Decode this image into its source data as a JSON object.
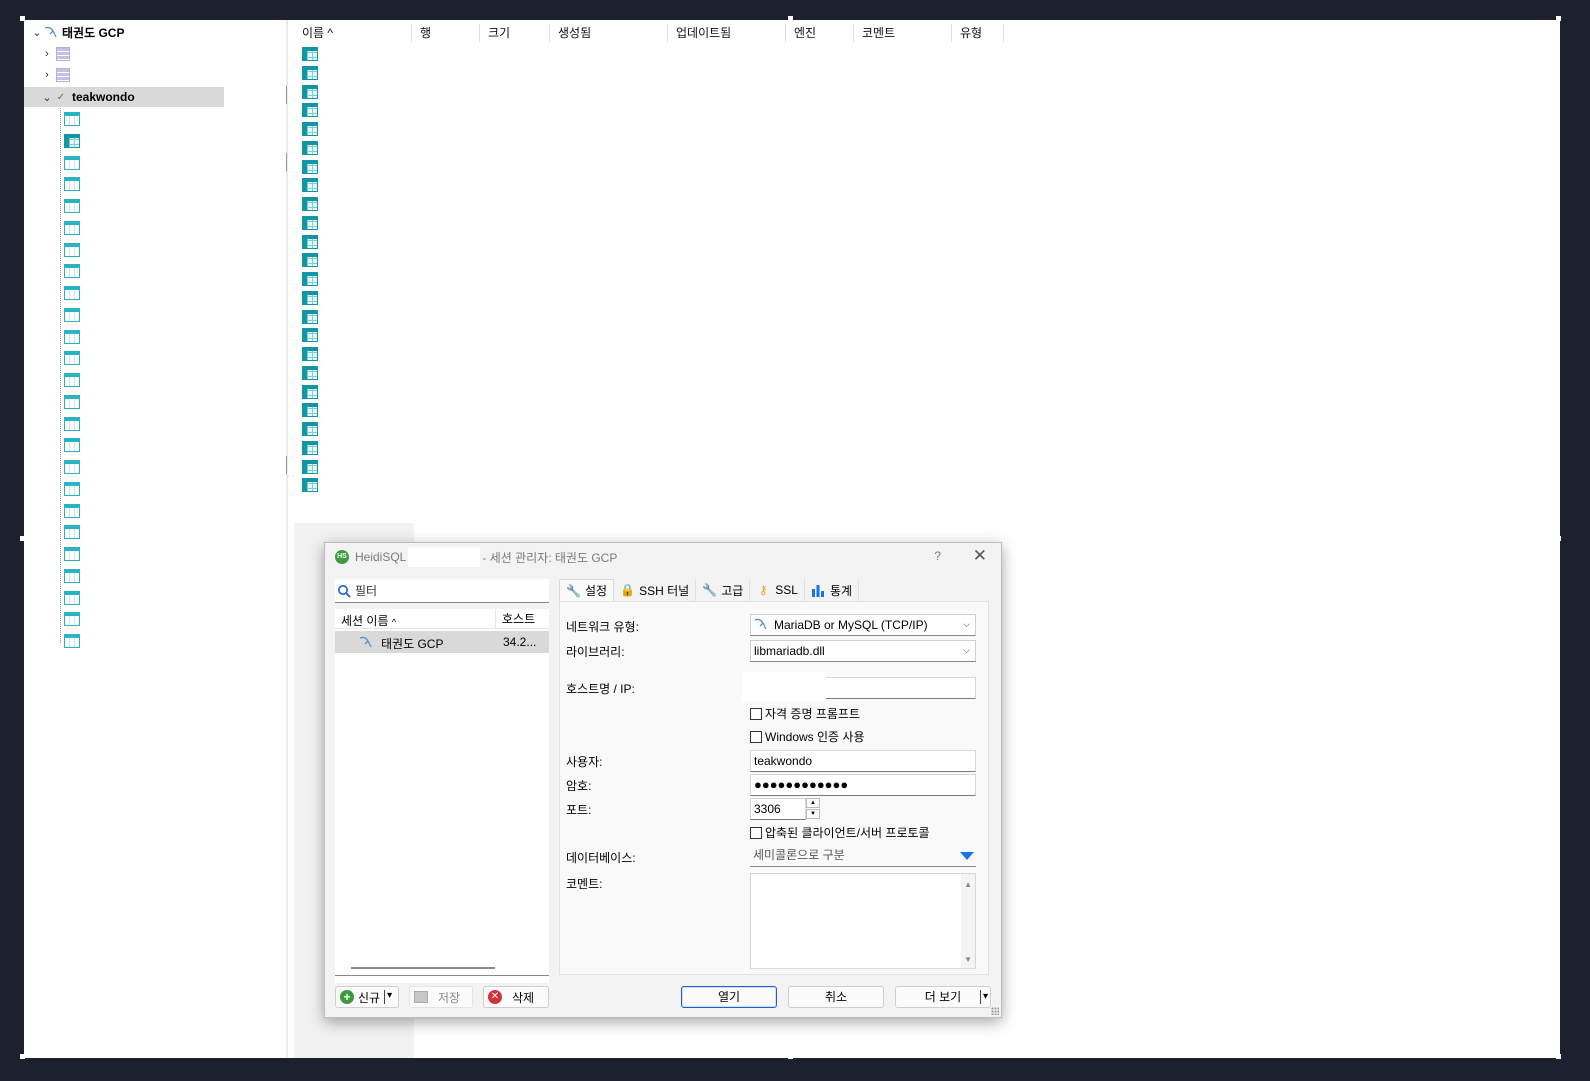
{
  "tree": {
    "root_label": "태권도 GCP",
    "selected_db_label": "teakwondo",
    "table_count": 25
  },
  "list": {
    "columns": [
      "이름",
      "행",
      "크기",
      "생성됨",
      "업데이트됨",
      "엔진",
      "코멘트",
      "유형"
    ],
    "sort_indicator": "^",
    "table_rows": 24
  },
  "dialog": {
    "title_app": "HeidiSQL",
    "title_rest": "- 세션 관리자: 태권도 GCP",
    "help": "?",
    "close": "✕",
    "filter_placeholder": "필터",
    "session_columns": {
      "name": "세션 이름",
      "host": "호스트"
    },
    "sessions": [
      {
        "name": "태권도 GCP",
        "host": "34.2..."
      }
    ],
    "buttons": {
      "new": "신규",
      "save": "저장",
      "delete": "삭제",
      "open": "열기",
      "cancel": "취소",
      "more": "더 보기"
    },
    "tabs": [
      {
        "label": "설정",
        "icon": "wrench-icon"
      },
      {
        "label": "SSH 터널",
        "icon": "lock-icon"
      },
      {
        "label": "고급",
        "icon": "wrench-orange-icon"
      },
      {
        "label": "SSL",
        "icon": "key-icon"
      },
      {
        "label": "통계",
        "icon": "bar-chart-icon"
      }
    ],
    "settings": {
      "network_type_label": "네트워크 유형:",
      "network_type_value": "MariaDB or MySQL (TCP/IP)",
      "library_label": "라이브러리:",
      "library_value": "libmariadb.dll",
      "host_label": "호스트명 / IP:",
      "host_value": "",
      "credential_prompt": "자격 증명 프롬프트",
      "windows_auth": "Windows 인증 사용",
      "user_label": "사용자:",
      "user_value": "teakwondo",
      "password_label": "암호:",
      "password_value": "●●●●●●●●●●●●",
      "port_label": "포트:",
      "port_value": "3306",
      "compressed": "압축된 클라이언트/서버 프로토콜",
      "database_label": "데이터베이스:",
      "database_placeholder": "세미콜론으로 구분",
      "comment_label": "코멘트:"
    }
  },
  "colors": {
    "accent_blue": "#1a73e8",
    "table_icon": "#2ab3c2",
    "selected_row": "#d9d9d9"
  }
}
